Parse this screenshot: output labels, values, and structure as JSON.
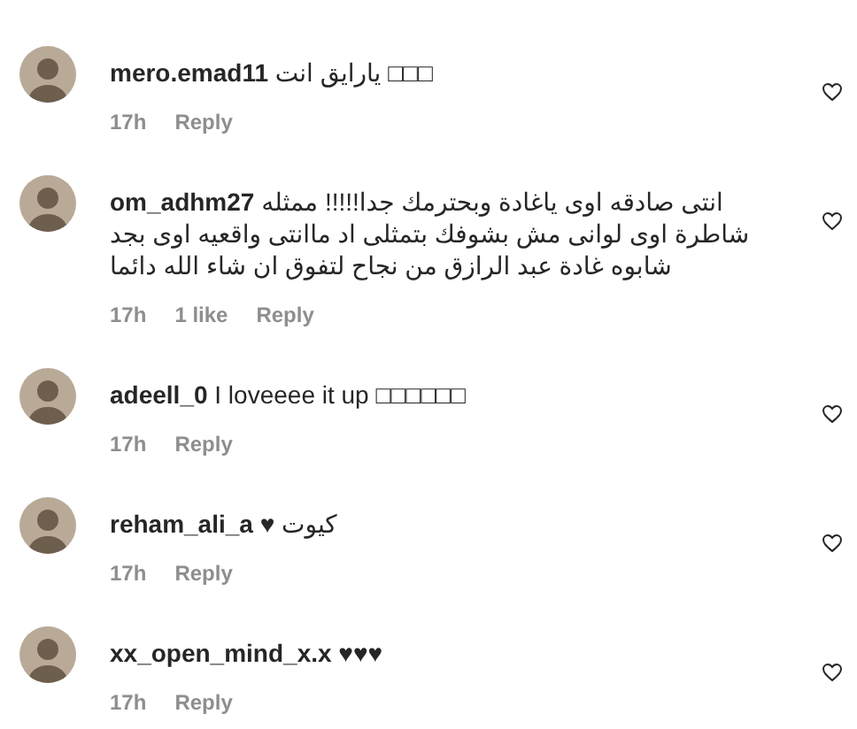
{
  "comments": [
    {
      "username": "mero.emad11",
      "text": "يارايق انت □□□",
      "time": "17h",
      "reply": "Reply",
      "liked": false
    },
    {
      "username": "om_adhm27",
      "text": "انتى صادقه اوى ياغادة وبحترمك جدا!!!!! ممثله شاطرة اوى لوانى مش بشوفك بتمثلى اد ماانتى واقعيه اوى بجد شابوه غادة عبد الرازق من نجاح لتفوق ان شاء الله دائما",
      "time": "17h",
      "likes": "1 like",
      "reply": "Reply",
      "liked": false
    },
    {
      "username": "adeell_0",
      "text": "I loveeee it up □□□□□□",
      "time": "17h",
      "reply": "Reply",
      "liked": false
    },
    {
      "username": "reham_ali_a",
      "text": "♥ كيوت",
      "time": "17h",
      "reply": "Reply",
      "liked": false
    },
    {
      "username": "xx_open_mind_x.x",
      "text": "♥♥♥",
      "time": "17h",
      "reply": "Reply",
      "liked": false
    }
  ]
}
